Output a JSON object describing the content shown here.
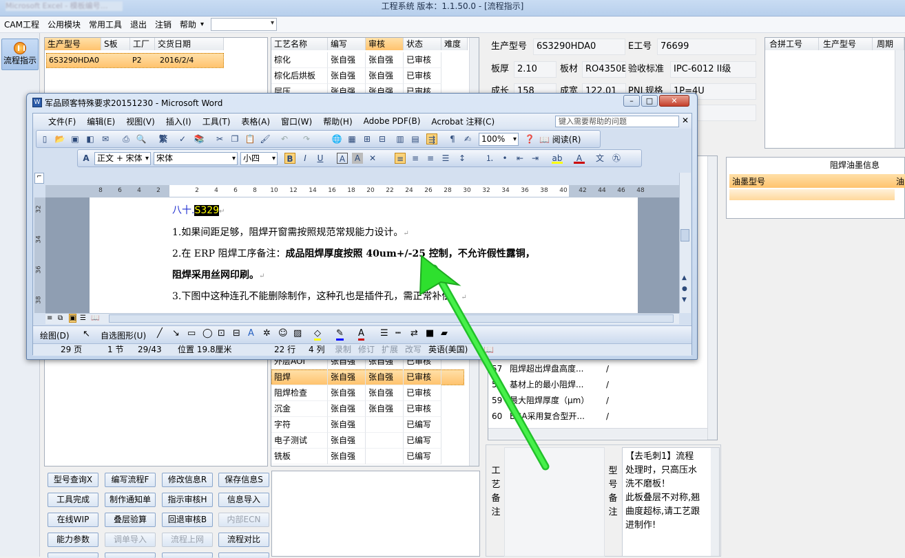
{
  "app": {
    "title": "工程系统   版本：1.1.50.0 - [流程指示]",
    "title_blur": "Microsoft Excel - 模板编号…"
  },
  "menu": {
    "items": [
      "CAM工程",
      "公用模块",
      "常用工具",
      "退出",
      "注销",
      "帮助"
    ],
    "dropdown_arrow": "▾"
  },
  "left_nav": {
    "flow_label": "流程指示"
  },
  "order_grid": {
    "headers": [
      "生产型号",
      "S板",
      "工厂",
      "交货日期"
    ],
    "rows": [
      [
        "6S3290HDA0",
        "",
        "P2",
        "2016/2/4"
      ]
    ]
  },
  "process_grid": {
    "headers": [
      "工艺名称",
      "编写",
      "审核",
      "状态",
      "难度"
    ],
    "rows_top": [
      [
        "棕化",
        "张自强",
        "张自强",
        "已审核"
      ],
      [
        "棕化后烘板",
        "张自强",
        "张自强",
        "已审核"
      ],
      [
        "层压",
        "张自强",
        "张自强",
        "已审核"
      ]
    ],
    "rows_bottom": [
      [
        "外层AOI",
        "张自强",
        "张自强",
        "已审核"
      ],
      [
        "阻焊",
        "张自强",
        "张自强",
        "已审核"
      ],
      [
        "阻焊检查",
        "张自强",
        "张自强",
        "已审核"
      ],
      [
        "沉金",
        "张自强",
        "张自强",
        "已审核"
      ],
      [
        "字符",
        "张自强",
        "",
        "已编写"
      ],
      [
        "电子测试",
        "张自强",
        "",
        "已编写"
      ],
      [
        "铣板",
        "张自强",
        "",
        "已编写"
      ]
    ]
  },
  "info": {
    "model_label": "生产型号",
    "model_value": "6S3290HDA0",
    "eno_label": "E工号",
    "eno_value": "76699",
    "thickness_label": "板厚",
    "thickness_value": "2.10",
    "material_label": "板材",
    "material_value": "RO4350B",
    "accept_label": "验收标准",
    "accept_value": "IPC-6012 II级",
    "row3_label1": "成长",
    "row3_value1": "158",
    "row3_label2": "成宽",
    "row3_value2": "122.01",
    "row3_label3": "PNL规格",
    "row3_value3": "1P=4U"
  },
  "merge_grid": {
    "headers": [
      "合拼工号",
      "生产型号",
      "周期"
    ]
  },
  "solder_ink": {
    "title": "阻焊油墨信息",
    "col1": "油墨型号",
    "col2": "油"
  },
  "req_table": {
    "rows": [
      [
        "57",
        "阻焊超出焊盘高度...",
        "/"
      ],
      [
        "58",
        "基材上的最小阻焊...",
        "/"
      ],
      [
        "59",
        "最大阻焊厚度（μm）",
        "/"
      ],
      [
        "60",
        "BGA采用复合型开...",
        "/"
      ]
    ]
  },
  "notes": {
    "process_label": [
      "工",
      "艺",
      "备",
      "注"
    ],
    "model_label": [
      "型",
      "号",
      "备",
      "注"
    ],
    "model_note": [
      "【去毛刺1】流程",
      "处理时，只高压水",
      "洗不磨板！",
      "此板叠层不对称,翘",
      "曲度超标,请工艺跟",
      "进制作!"
    ]
  },
  "buttons": [
    {
      "label": "型号查询X",
      "disabled": false
    },
    {
      "label": "编写流程F",
      "disabled": false
    },
    {
      "label": "修改信息R",
      "disabled": false
    },
    {
      "label": "保存信息S",
      "disabled": false
    },
    {
      "label": "工具完成",
      "disabled": false
    },
    {
      "label": "制作通知单",
      "disabled": false
    },
    {
      "label": "指示审核H",
      "disabled": false
    },
    {
      "label": "信息导入",
      "disabled": false
    },
    {
      "label": "在线WIP",
      "disabled": false
    },
    {
      "label": "叠层验算",
      "disabled": false
    },
    {
      "label": "回退审核B",
      "disabled": false
    },
    {
      "label": "内部ECN",
      "disabled": true
    },
    {
      "label": "能力参数",
      "disabled": false
    },
    {
      "label": "调单导入",
      "disabled": true
    },
    {
      "label": "流程上网",
      "disabled": true
    },
    {
      "label": "流程对比",
      "disabled": false
    }
  ],
  "word": {
    "title": "军品顾客特殊要求20151230 - Microsoft Word",
    "menu": [
      "文件(F)",
      "编辑(E)",
      "视图(V)",
      "插入(I)",
      "工具(T)",
      "表格(A)",
      "窗口(W)",
      "帮助(H)",
      "Adobe PDF(B)",
      "Acrobat 注释(C)"
    ],
    "help_placeholder": "键入需要帮助的问题",
    "zoom": "100%",
    "read_label": "阅读(R)",
    "style": "正文 + 宋体",
    "font": "宋体",
    "size": "小四",
    "ruler_nums": [
      "8",
      "6",
      "4",
      "2",
      "",
      "2",
      "4",
      "6",
      "8",
      "10",
      "12",
      "14",
      "16",
      "18",
      "20",
      "22",
      "24",
      "26",
      "28",
      "30",
      "32",
      "34",
      "36",
      "38",
      "40",
      "42",
      "44",
      "46",
      "48"
    ],
    "vruler_nums": [
      "32",
      "34",
      "36",
      "38"
    ],
    "heading_prefix": "八十.",
    "heading_highlight": "S329",
    "line1": "1.如果间距足够，阻焊开窗需按照规范常规能力设计。",
    "line2_normal": "2.在 ERP 阻焊工序备注：",
    "line2_bold": "成品阻焊厚度按照 40um+/-25 控制，不允许假性露铜，",
    "line3_bold": "阻焊采用丝网印刷。",
    "line4": "3.下图中这种连孔不能删除制作，这种孔也是插件孔，需正常补偿。",
    "para_mark": "↵",
    "draw_label": "绘图(D)",
    "autoshape_label": "自选图形(U)",
    "status": {
      "page": "29 页",
      "section": "1 节",
      "pages": "29/43",
      "pos": "位置 19.8厘米",
      "line": "22 行",
      "col": "4 列",
      "rec": "录制",
      "trk": "修订",
      "ext": "扩展",
      "ovr": "改写",
      "lang": "英语(美国)"
    }
  },
  "colors": {
    "arrow": "#2ee02e",
    "highlight": "#000000",
    "selection": "#ffc36e"
  }
}
